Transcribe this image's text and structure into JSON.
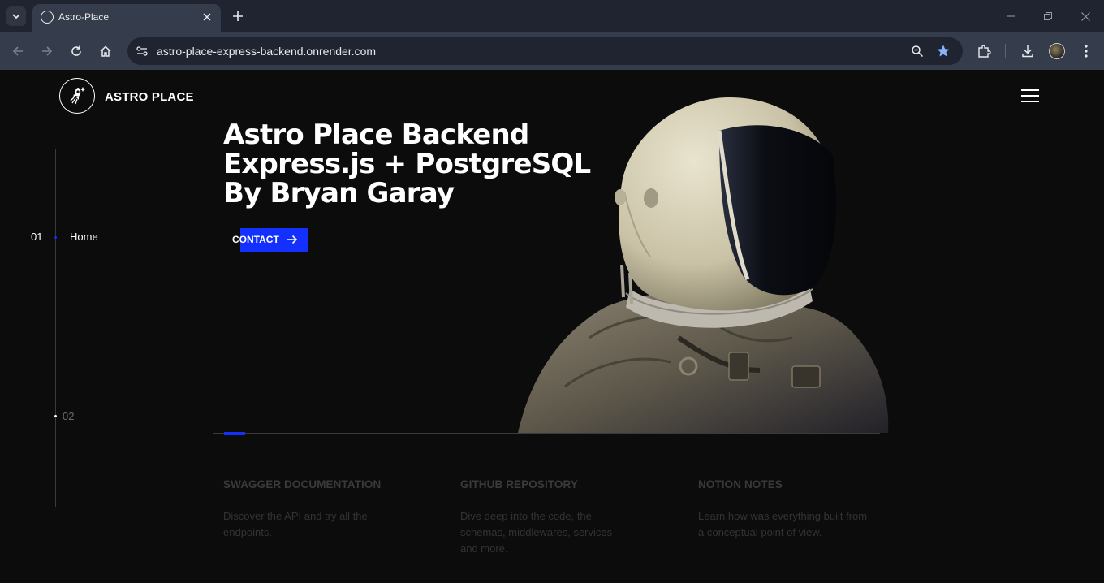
{
  "browser": {
    "tab_title": "Astro-Place",
    "url": "astro-place-express-backend.onrender.com"
  },
  "site": {
    "logo_text": "ASTRO PLACE",
    "hero_lines": [
      "Astro Place Backend",
      "Express.js + PostgreSQL",
      "By Bryan Garay"
    ],
    "contact_label": "CONTACT",
    "side_nav": [
      {
        "num": "01",
        "label": "Home",
        "active": true
      },
      {
        "num": "02",
        "label": "",
        "active": false
      }
    ],
    "slider_progress": 0.032,
    "features": [
      {
        "title": "SWAGGER DOCUMENTATION",
        "desc": "Discover the API and try all the endpoints."
      },
      {
        "title": "GITHUB REPOSITORY",
        "desc": "Dive deep into the code, the schemas, middlewares, services and more."
      },
      {
        "title": "NOTION NOTES",
        "desc": "Learn how was everything built from a conceptual point of view."
      }
    ]
  },
  "colors": {
    "accent": "#1430ff",
    "background": "#0c0c0d",
    "chrome": "#353c4b"
  },
  "icons": [
    "tab-search-icon",
    "favicon-icon",
    "close-icon",
    "plus-icon",
    "minimize-icon",
    "restore-icon",
    "back-icon",
    "forward-icon",
    "reload-icon",
    "home-icon",
    "site-info-icon",
    "zoom-icon",
    "star-icon",
    "extensions-icon",
    "download-icon",
    "menu-icon",
    "rocket-logo-icon",
    "hamburger-icon",
    "arrow-right-icon"
  ]
}
